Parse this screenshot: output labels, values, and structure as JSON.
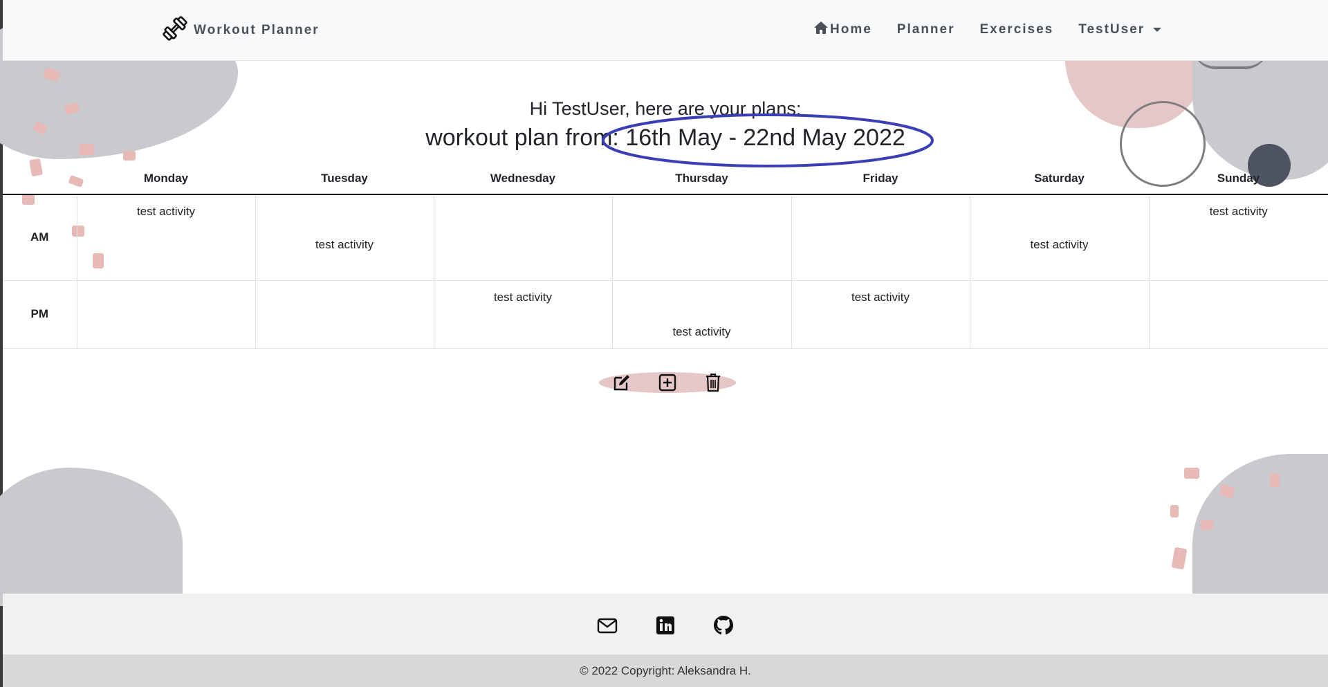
{
  "navbar": {
    "brand": "Workout Planner",
    "links": [
      {
        "label": "Home",
        "icon": "home-icon"
      },
      {
        "label": "Planner"
      },
      {
        "label": "Exercises"
      },
      {
        "label": "TestUser",
        "dropdown": true
      }
    ]
  },
  "greeting": "Hi TestUser, here are your plans:",
  "plan_title": "workout plan from: 16th May - 22nd May 2022",
  "table": {
    "days": [
      "Monday",
      "Tuesday",
      "Wednesday",
      "Thursday",
      "Friday",
      "Saturday",
      "Sunday"
    ],
    "rows": [
      {
        "label": "AM",
        "cells": [
          "test activity",
          "test activity",
          "",
          "",
          "",
          "test activity",
          "test activity"
        ]
      },
      {
        "label": "PM",
        "cells": [
          "",
          "",
          "test activity",
          "test activity",
          "test activity",
          "",
          ""
        ]
      }
    ]
  },
  "actions": [
    "edit-icon",
    "add-icon",
    "delete-icon"
  ],
  "footer": {
    "social": [
      "mail-icon",
      "linkedin-icon",
      "github-icon"
    ],
    "copyright": "© 2022 Copyright: Aleksandra H."
  },
  "colors": {
    "navbar_bg": "#f8f9fa",
    "nav_text": "#4b4f58",
    "accent_pink": "#e6c7c8",
    "highlight_ellipse": "#3b3fb5",
    "footer_bg": "#f1f1f1"
  }
}
